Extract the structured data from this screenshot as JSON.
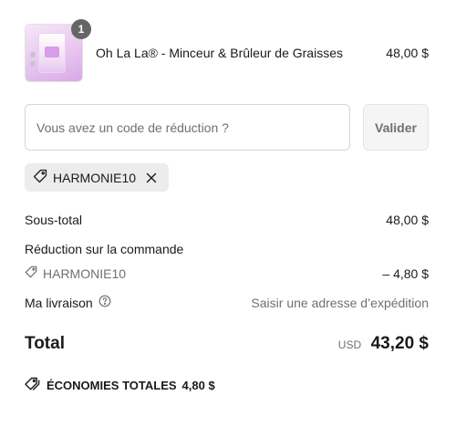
{
  "product": {
    "quantity": "1",
    "name": "Oh La La® - Minceur & Brûleur de Graisses",
    "price": "48,00 $"
  },
  "discount": {
    "placeholder": "Vous avez un code de réduction ?",
    "apply_label": "Valider",
    "applied_code": "HARMONIE10"
  },
  "summary": {
    "subtotal_label": "Sous-total",
    "subtotal_value": "48,00 $",
    "order_discount_label": "Réduction sur la commande",
    "order_discount_code": "HARMONIE10",
    "order_discount_value": "– 4,80 $",
    "shipping_label": "Ma livraison",
    "shipping_value": "Saisir une adresse d’expédition",
    "total_label": "Total",
    "total_currency": "USD",
    "total_value": "43,20 $",
    "savings_label": "ÉCONOMIES TOTALES",
    "savings_value": "4,80 $"
  },
  "icons": {
    "tag": "tag-icon",
    "close": "close-icon",
    "help": "help-circle-icon",
    "tags": "tags-icon"
  },
  "colors": {
    "muted_text": "#707070",
    "chip_background": "#ececec",
    "badge_background": "#666666",
    "product_tint": "#e8c6ef"
  }
}
